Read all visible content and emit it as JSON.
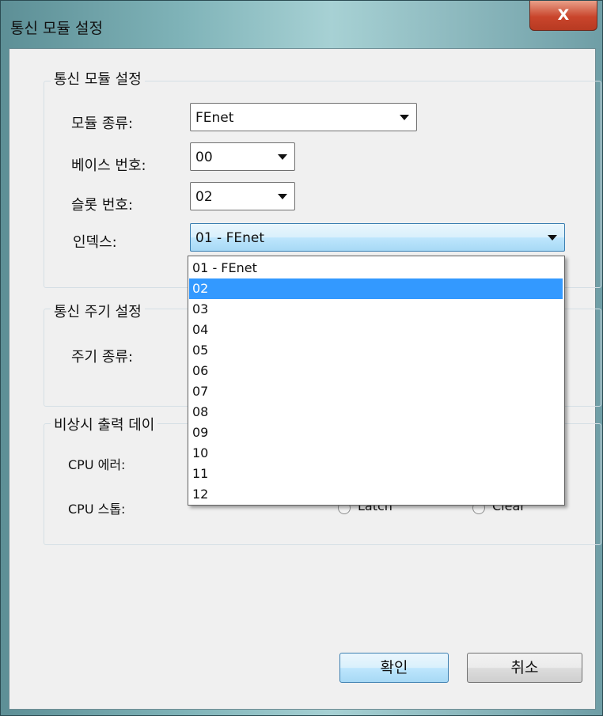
{
  "window": {
    "title": "통신 모듈 설정",
    "close_label": "X"
  },
  "group_module": {
    "title": "통신 모듈 설정",
    "module_type_label": "모듈 종류:",
    "module_type_value": "FEnet",
    "base_label": "베이스 번호:",
    "base_value": "00",
    "slot_label": "슬롯 번호:",
    "slot_value": "02",
    "index_label": "인덱스:",
    "index_value": "01 - FEnet"
  },
  "index_dropdown": {
    "options": [
      "01 - FEnet",
      "02",
      "03",
      "04",
      "05",
      "06",
      "07",
      "08",
      "09",
      "10",
      "11",
      "12"
    ],
    "highlighted": "02"
  },
  "group_cycle": {
    "title": "통신 주기 설정",
    "cycle_type_label": "주기 종류:"
  },
  "group_emergency": {
    "title": "비상시 출력 데이",
    "cpu_error_label": "CPU 에러:",
    "cpu_stop_label": "CPU 스톱:",
    "cpu_stop_latch_label": "Latch",
    "cpu_stop_clear_label": "Clear"
  },
  "buttons": {
    "ok": "확인",
    "cancel": "취소"
  },
  "colors": {
    "selection": "#3399ff",
    "close_button": "#c9452c",
    "dialog_bg": "#f0f0f0"
  }
}
